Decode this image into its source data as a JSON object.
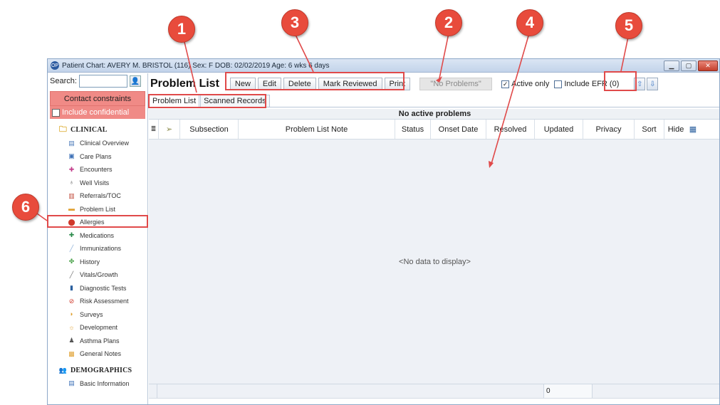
{
  "window": {
    "title": "Patient Chart: AVERY M. BRISTOL (116)  Sex: F  DOB: 02/02/2019  Age: 6 wks 6 days",
    "logo_text": "OP"
  },
  "sidebar": {
    "search_label": "Search:",
    "search_value": "",
    "contact_constraints": "Contact constraints",
    "include_confidential": "Include confidential",
    "clinical_heading": "CLINICAL",
    "clinical_items": [
      {
        "label": "Clinical Overview",
        "icon": "overview-icon"
      },
      {
        "label": "Care Plans",
        "icon": "care-plans-icon"
      },
      {
        "label": "Encounters",
        "icon": "encounters-icon"
      },
      {
        "label": "Well Visits",
        "icon": "well-visits-icon"
      },
      {
        "label": "Referrals/TOC",
        "icon": "referrals-icon"
      },
      {
        "label": "Problem List",
        "icon": "problem-list-icon"
      },
      {
        "label": "Allergies",
        "icon": "allergies-icon"
      },
      {
        "label": "Medications",
        "icon": "medications-icon"
      },
      {
        "label": "Immunizations",
        "icon": "immunizations-icon"
      },
      {
        "label": "History",
        "icon": "history-icon"
      },
      {
        "label": "Vitals/Growth",
        "icon": "vitals-icon"
      },
      {
        "label": "Diagnostic Tests",
        "icon": "diagnostic-tests-icon"
      },
      {
        "label": "Risk Assessment",
        "icon": "risk-assessment-icon"
      },
      {
        "label": "Surveys",
        "icon": "surveys-icon"
      },
      {
        "label": "Development",
        "icon": "development-icon"
      },
      {
        "label": "Asthma Plans",
        "icon": "asthma-plans-icon"
      },
      {
        "label": "General Notes",
        "icon": "general-notes-icon"
      }
    ],
    "demographics_heading": "DEMOGRAPHICS",
    "demographics_items": [
      {
        "label": "Basic Information",
        "icon": "basic-information-icon"
      }
    ]
  },
  "toolbar": {
    "title": "Problem List",
    "new": "New",
    "edit": "Edit",
    "delete": "Delete",
    "mark_reviewed": "Mark Reviewed",
    "print": "Print",
    "status": "\"No Problems\"",
    "active_only": "Active only",
    "include_efr": "Include EFR (0)"
  },
  "tabs": [
    "Problem List",
    "Scanned Records"
  ],
  "banner": "No active problems",
  "grid": {
    "columns": [
      "Subsection",
      "Problem List Note",
      "Status",
      "Onset Date",
      "Resolved",
      "Updated",
      "Privacy",
      "Sort",
      "Hide"
    ],
    "empty_text": "<No data to display>",
    "footer_count": "0"
  },
  "callouts": [
    "1",
    "2",
    "3",
    "4",
    "5",
    "6"
  ],
  "colors": {
    "callout": "#e84b3c",
    "highlight": "#e04a4a",
    "contact_bg": "#f08a86"
  }
}
